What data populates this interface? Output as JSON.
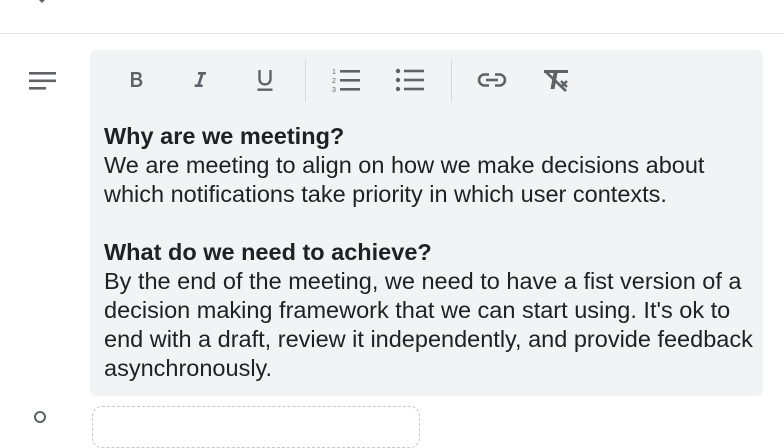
{
  "icons": {
    "top": "chevron-down-icon",
    "description": "notes-icon",
    "bold": "bold-icon",
    "italic": "italic-icon",
    "underline": "underline-icon",
    "numbered_list": "numbered-list-icon",
    "bulleted_list": "bulleted-list-icon",
    "link": "link-icon",
    "clear_formatting": "clear-formatting-icon",
    "bottom": "person-icon"
  },
  "colors": {
    "editor_background": "#f1f3f4",
    "icon": "#5f6368",
    "text": "#202124"
  },
  "description": {
    "heading_1": "Why are we meeting?",
    "paragraph_1": "We are meeting to align on how we make decisions about which notifications take priority in which user contexts.",
    "heading_2": "What do we need to achieve?",
    "paragraph_2": "By the end of the meeting, we need to have a fist version of a decision making framework that we can start using. It's ok to end with a draft, review it independently, and provide feedback asynchronously."
  }
}
